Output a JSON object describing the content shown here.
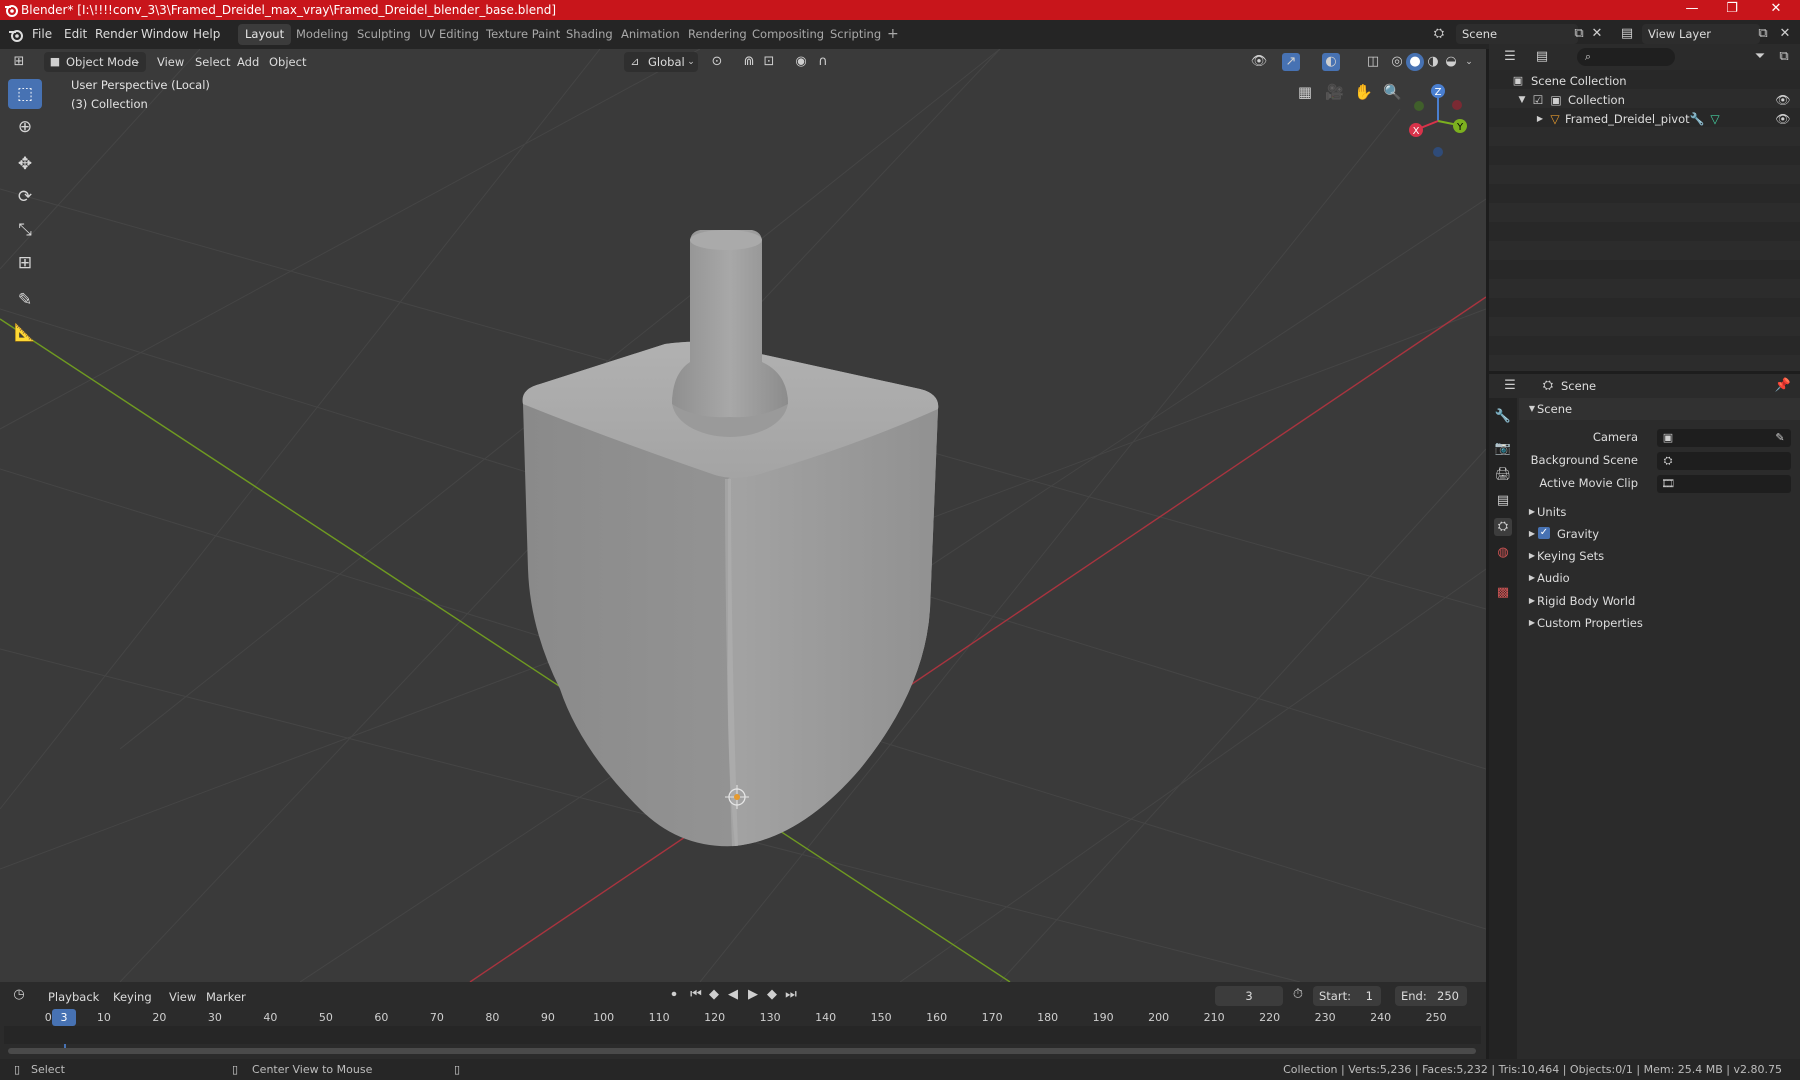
{
  "window": {
    "title": "Blender* [I:\\!!!!conv_3\\3\\Framed_Dreidel_max_vray\\Framed_Dreidel_blender_base.blend]",
    "controls": [
      "—",
      "❐",
      "✕"
    ]
  },
  "menu": {
    "items": [
      "File",
      "Edit",
      "Render",
      "Window",
      "Help"
    ],
    "workspaces": [
      "Layout",
      "Modeling",
      "Sculpting",
      "UV Editing",
      "Texture Paint",
      "Shading",
      "Animation",
      "Rendering",
      "Compositing",
      "Scripting"
    ],
    "active_workspace": "Layout",
    "add_tab": "+",
    "scene_name": "Scene",
    "view_layer": "View Layer"
  },
  "viewport_header": {
    "mode": "Object Mode",
    "menus": [
      "View",
      "Select",
      "Add",
      "Object"
    ],
    "orientation": "Global"
  },
  "viewport": {
    "perspective_label": "User Perspective (Local)",
    "collection_label": "(3) Collection",
    "gizmo_axes": [
      "Z",
      "Y",
      "X"
    ],
    "background_color": "#3a3a3a",
    "x_axis_color": "#a8343f",
    "y_axis_color": "#6f9a21"
  },
  "outliner": {
    "root": "Scene Collection",
    "collection": "Collection",
    "object": "Framed_Dreidel_pivot"
  },
  "properties": {
    "header": "Scene",
    "panel_title": "Scene",
    "fields": [
      {
        "label": "Camera",
        "value": ""
      },
      {
        "label": "Background Scene",
        "value": ""
      },
      {
        "label": "Active Movie Clip",
        "value": ""
      }
    ],
    "sections": [
      "Units",
      "Gravity",
      "Keying Sets",
      "Audio",
      "Rigid Body World",
      "Custom Properties"
    ],
    "gravity_checked": true
  },
  "timeline": {
    "menus": [
      "Playback",
      "Keying",
      "View",
      "Marker"
    ],
    "current_frame": "3",
    "start_label": "Start:",
    "start": "1",
    "end_label": "End:",
    "end": "250",
    "ruler": [
      "0",
      "10",
      "20",
      "30",
      "40",
      "50",
      "60",
      "70",
      "80",
      "90",
      "100",
      "110",
      "120",
      "130",
      "140",
      "150",
      "160",
      "170",
      "180",
      "190",
      "200",
      "210",
      "220",
      "230",
      "240",
      "250"
    ],
    "playhead_label": "3"
  },
  "statusbar": {
    "select": "Select",
    "center_view": "Center View to Mouse",
    "stats": "Collection | Verts:5,236 | Faces:5,232 | Tris:10,464 | Objects:0/1 | Mem: 25.4 MB | v2.80.75"
  }
}
